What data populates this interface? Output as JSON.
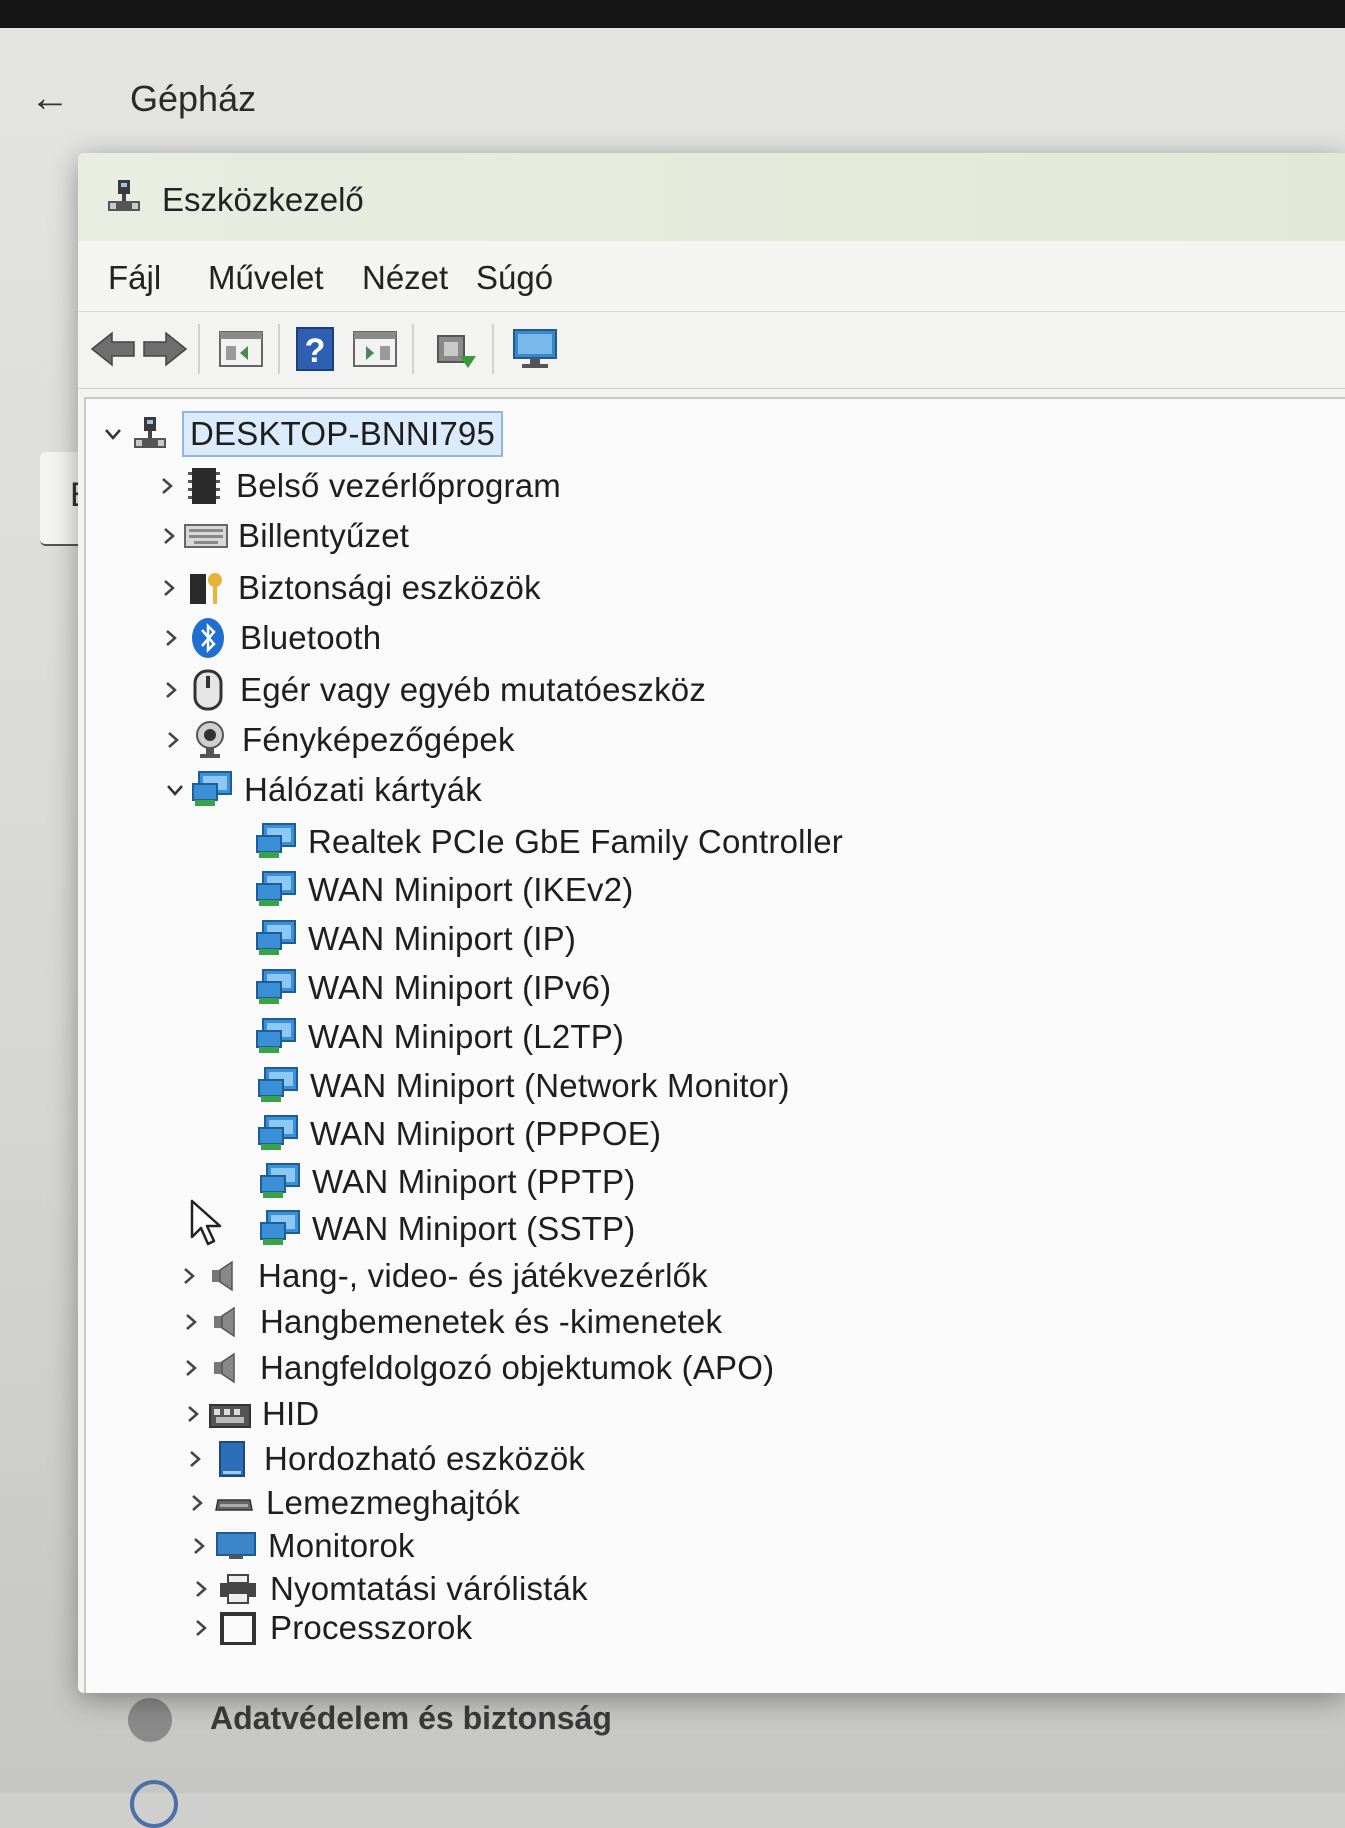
{
  "settings": {
    "title": "Gépház",
    "side_card_letter": "E",
    "bottom_item": "Adatvédelem és biztonság"
  },
  "window": {
    "title": "Eszközkezelő"
  },
  "menu": {
    "file": "Fájl",
    "action": "Művelet",
    "view": "Nézet",
    "help": "Súgó"
  },
  "toolbar": {
    "question_mark": "?"
  },
  "tree": {
    "root": "DESKTOP-BNNI795",
    "categories": {
      "firmware": "Belső vezérlőprogram",
      "keyboard": "Billentyűzet",
      "security": "Biztonsági eszközök",
      "bluetooth": "Bluetooth",
      "mouse": "Egér vagy egyéb mutatóeszköz",
      "cameras": "Fényképezőgépek",
      "network": "Hálózati kártyák",
      "sound": "Hang-, video- és játékvezérlők",
      "audio_io": "Hangbemenetek és -kimenetek",
      "apo": "Hangfeldolgozó objektumok (APO)",
      "hid": "HID",
      "portable": "Hordozható eszközök",
      "disks": "Lemezmeghajtók",
      "monitors": "Monitorok",
      "print_queues": "Nyomtatási várólisták",
      "processors": "Processzorok"
    },
    "network_devices": [
      "Realtek PCIe GbE Family Controller",
      "WAN Miniport (IKEv2)",
      "WAN Miniport (IP)",
      "WAN Miniport (IPv6)",
      "WAN Miniport (L2TP)",
      "WAN Miniport (Network Monitor)",
      "WAN Miniport (PPPOE)",
      "WAN Miniport (PPTP)",
      "WAN Miniport (SSTP)"
    ]
  }
}
